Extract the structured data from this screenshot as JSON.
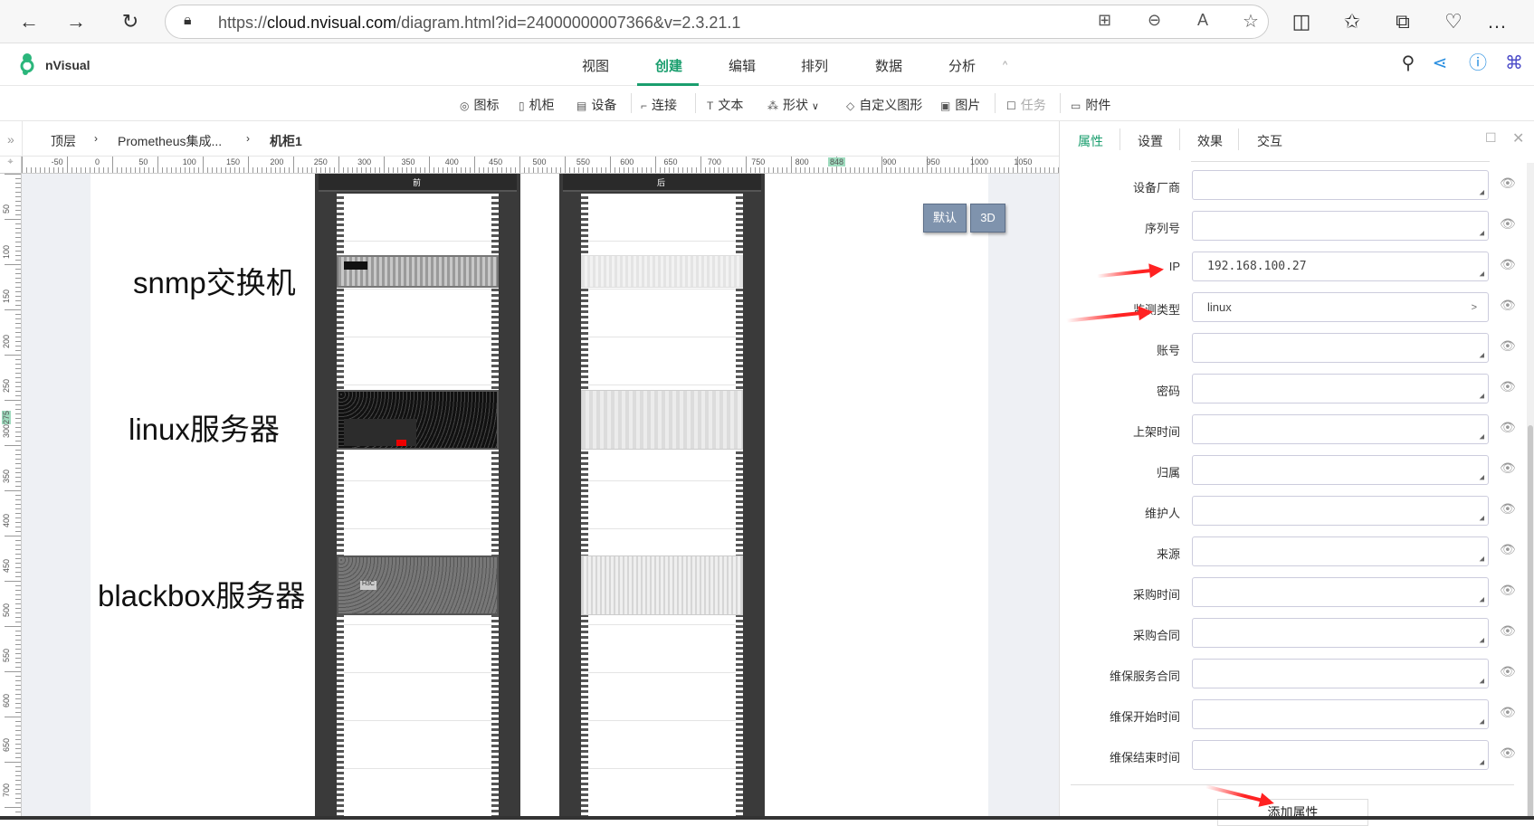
{
  "browser": {
    "url_prefix": "https://",
    "url_host": "cloud.nvisual.com",
    "url_path": "/diagram.html?id=24000000007366&v=2.3.21.1"
  },
  "app": {
    "name": "nVisual"
  },
  "menu": [
    {
      "label": "视图"
    },
    {
      "label": "创建",
      "active": true
    },
    {
      "label": "编辑"
    },
    {
      "label": "排列"
    },
    {
      "label": "数据"
    },
    {
      "label": "分析"
    }
  ],
  "collapse_icon": "^",
  "toolbar": [
    {
      "label": "图标",
      "icon": "◎"
    },
    {
      "label": "机柜",
      "icon": "▯"
    },
    {
      "label": "设备",
      "icon": "▤"
    },
    {
      "label": "连接",
      "icon": "⌐"
    },
    {
      "label": "文本",
      "icon": "T"
    },
    {
      "label": "形状",
      "icon": "⁂"
    },
    {
      "label": "自定义图形",
      "icon": "◇"
    },
    {
      "label": "图片",
      "icon": "▣"
    },
    {
      "label": "任务",
      "icon": "☐",
      "disabled": true
    },
    {
      "label": "附件",
      "icon": "▭"
    }
  ],
  "breadcrumb": [
    "顶层",
    "Prometheus集成...",
    "机柜1"
  ],
  "ruler": {
    "h_labels": [
      "-50",
      "0",
      "50",
      "100",
      "150",
      "200",
      "250",
      "300",
      "350",
      "400",
      "450",
      "500",
      "550",
      "600",
      "650",
      "700",
      "750",
      "800",
      "848",
      "900",
      "950",
      "1000",
      "1050"
    ],
    "h_highlight": "848",
    "v_labels": [
      "50",
      "100",
      "150",
      "200",
      "250",
      "275",
      "300",
      "350",
      "400",
      "450",
      "500",
      "550",
      "600",
      "650",
      "700"
    ],
    "v_highlight": "275"
  },
  "canvas": {
    "labels": [
      "snmp交换机",
      "linux服务器",
      "blackbox服务器"
    ],
    "rack_front": "前",
    "rack_back": "后",
    "view_default": "默认",
    "view_3d": "3D"
  },
  "panel": {
    "tabs": [
      "属性",
      "设置",
      "效果",
      "交互"
    ],
    "fields": [
      {
        "label": "设备厂商",
        "value": ""
      },
      {
        "label": "序列号",
        "value": ""
      },
      {
        "label": "IP",
        "value": "192.168.100.27"
      },
      {
        "label": "监测类型",
        "value": "linux",
        "select": true
      },
      {
        "label": "账号",
        "value": ""
      },
      {
        "label": "密码",
        "value": ""
      },
      {
        "label": "上架时间",
        "value": ""
      },
      {
        "label": "归属",
        "value": ""
      },
      {
        "label": "维护人",
        "value": ""
      },
      {
        "label": "来源",
        "value": ""
      },
      {
        "label": "采购时间",
        "value": ""
      },
      {
        "label": "采购合同",
        "value": ""
      },
      {
        "label": "维保服务合同",
        "value": ""
      },
      {
        "label": "维保开始时间",
        "value": ""
      },
      {
        "label": "维保结束时间",
        "value": ""
      }
    ],
    "select_arrow": ">",
    "add_button": "添加属性"
  },
  "colors": {
    "accent": "#1a9e6e",
    "annotation": "#ff2222"
  }
}
